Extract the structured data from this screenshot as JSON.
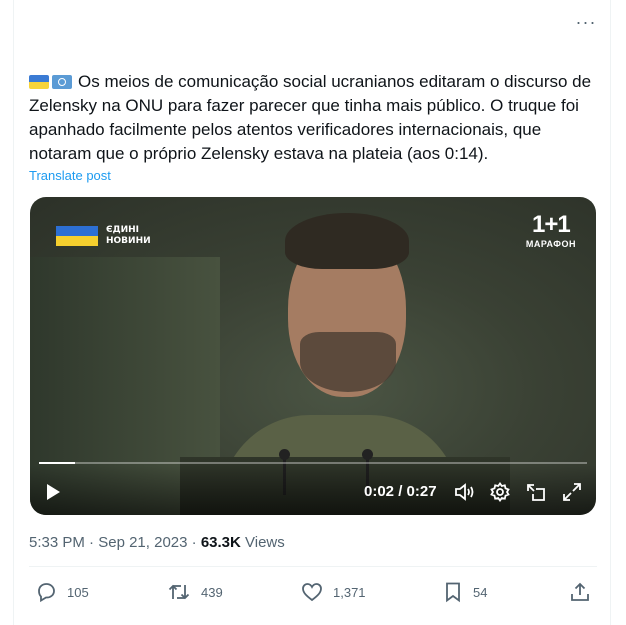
{
  "post": {
    "more_label": "···",
    "text": "Os meios de comunicação social ucranianos editaram o discurso de Zelensky na ONU para fazer parecer que tinha mais público. O truque foi apanhado facilmente pelos atentos verificadores internacionais, que notaram que o próprio Zelensky estava na plateia (aos 0:14).",
    "translate_label": "Translate post"
  },
  "video": {
    "channel_logo_line1": "ЄДИНІ",
    "channel_logo_line2": "НОВИНИ",
    "network_name": "1+1",
    "network_sub": "МАРАФОН",
    "time": "0:02 / 0:27",
    "progress": 0.065
  },
  "meta": {
    "time": "5:33 PM",
    "separator1": " · ",
    "date": "Sep 21, 2023",
    "separator2": " · ",
    "views_count": "63.3K",
    "views_label": " Views"
  },
  "actions": {
    "replies": "105",
    "reposts": "439",
    "likes": "1,371",
    "bookmarks": "54"
  },
  "colors": {
    "accent": "#1d9bf0",
    "muted": "#536471",
    "text": "#0f1419"
  }
}
